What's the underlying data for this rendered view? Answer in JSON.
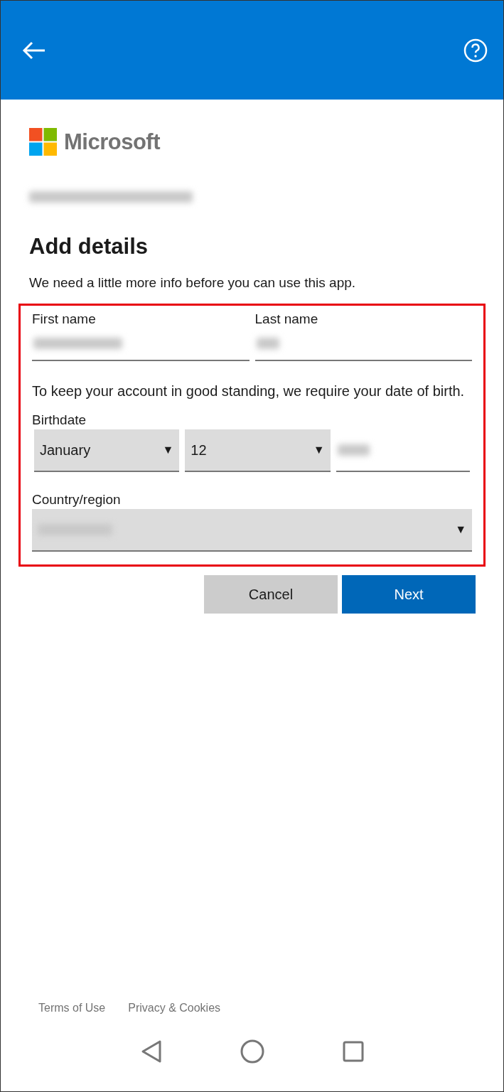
{
  "header": {
    "has_back": true,
    "has_help": true
  },
  "brand": {
    "name": "Microsoft"
  },
  "account": {
    "redacted": true
  },
  "title": "Add details",
  "subtitle": "We need a little more info before you can use this app.",
  "form": {
    "highlighted": true,
    "first_name": {
      "label": "First name",
      "redacted": true
    },
    "last_name": {
      "label": "Last name",
      "redacted": true
    },
    "note": "To keep your account in good standing, we require your date of birth.",
    "birthdate": {
      "label": "Birthdate",
      "month": "January",
      "day": "12",
      "caret": "▼",
      "year_redacted": true
    },
    "country": {
      "label": "Country/region",
      "redacted": true,
      "caret": "▼"
    }
  },
  "buttons": [
    {
      "kind": "secondary",
      "label": "Cancel"
    },
    {
      "kind": "primary",
      "label": "Next"
    }
  ],
  "footer_links": [
    "Terms of Use",
    "Privacy & Cookies"
  ]
}
